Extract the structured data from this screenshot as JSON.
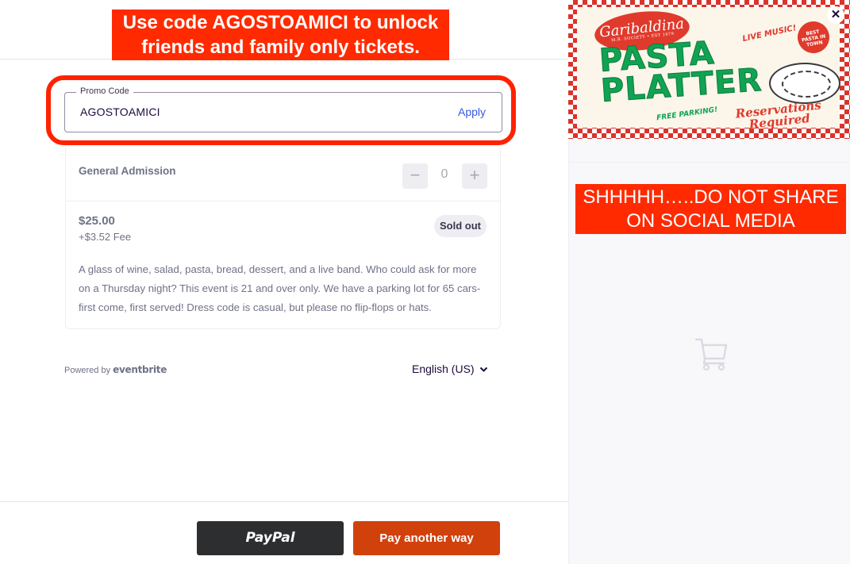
{
  "annotations": {
    "top_banner_line1": "Use code AGOSTOAMICI to unlock",
    "top_banner_line2": "friends and family only tickets.",
    "right_banner_line1": "SHHHHH…..DO NOT SHARE",
    "right_banner_line2": "ON SOCIAL MEDIA",
    "banner_color": "#ff2a00",
    "highlight_color": "#ff2200"
  },
  "promo": {
    "label": "Promo Code",
    "value": "AGOSTOAMICI",
    "apply_label": "Apply"
  },
  "ticket": {
    "name": "General Admission",
    "quantity": "0",
    "minus_symbol": "−",
    "plus_symbol": "+",
    "price": "$25.00",
    "fee": "+$3.52 Fee",
    "status": "Sold out",
    "description": "A glass of wine, salad, pasta, bread, dessert, and a live band. Who could ask for more on a Thursday night? This event is 21 and over only. We have a parking lot for 65 cars- first come, first served! Dress code is casual, but please no flip-flops or hats."
  },
  "footer": {
    "powered_prefix": "Powered by",
    "powered_brand": "eventbrite",
    "language": "English (US)"
  },
  "actions": {
    "paypal_label": "PayPal",
    "pay_other_label": "Pay another way",
    "pay_other_color": "#d1410c"
  },
  "poster": {
    "badge": "Garibaldina",
    "badge_sub": "M.B. SOCIETY • EST 1979",
    "line1": "PASTA",
    "line2": "PLATTER",
    "live": "LIVE MUSIC!",
    "best": "BEST PASTA IN TOWN",
    "free": "FREE PARKING!",
    "reservations": "Reservations Required"
  },
  "summary": {
    "close_symbol": "✕",
    "cart_icon": "shopping-cart-icon"
  }
}
